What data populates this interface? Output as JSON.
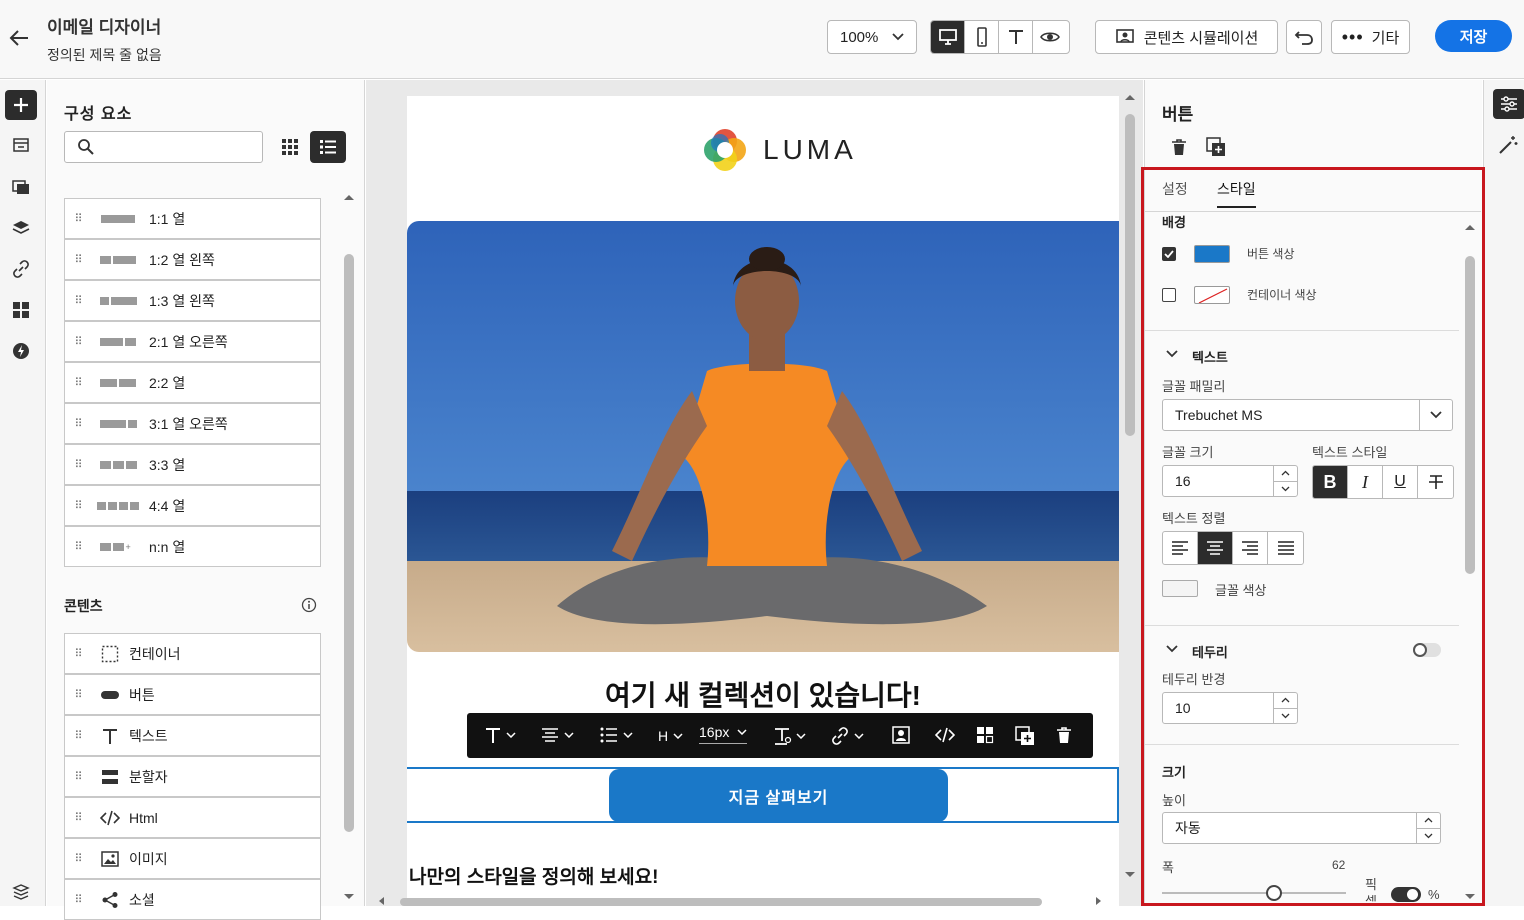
{
  "header": {
    "title": "이메일 디자이너",
    "subtitle": "정의된 제목 줄 없음",
    "zoom": "100%",
    "simulate_label": "콘텐츠 시뮬레이션",
    "more_label": "기타",
    "save_label": "저장"
  },
  "components": {
    "title": "구성 요소",
    "search_placeholder": "",
    "structures": [
      {
        "label": "1:1 열",
        "cols": [
          1
        ]
      },
      {
        "label": "1:2 열 왼쪽",
        "cols": [
          1,
          2
        ]
      },
      {
        "label": "1:3 열 왼쪽",
        "cols": [
          1,
          3
        ]
      },
      {
        "label": "2:1 열 오른쪽",
        "cols": [
          2,
          1
        ]
      },
      {
        "label": "2:2 열",
        "cols": [
          1,
          1
        ]
      },
      {
        "label": "3:1 열 오른쪽",
        "cols": [
          3,
          1
        ]
      },
      {
        "label": "3:3 열",
        "cols": [
          1,
          1,
          1
        ]
      },
      {
        "label": "4:4 열",
        "cols": [
          1,
          1,
          1,
          1
        ]
      },
      {
        "label": "n:n 열",
        "cols": [
          1,
          1,
          0
        ]
      }
    ],
    "content_title": "콘텐츠",
    "content_items": [
      {
        "label": "컨테이너",
        "icon": "container-icon"
      },
      {
        "label": "버튼",
        "icon": "button-icon"
      },
      {
        "label": "텍스트",
        "icon": "text-icon"
      },
      {
        "label": "분할자",
        "icon": "divider-icon"
      },
      {
        "label": "Html",
        "icon": "code-icon"
      },
      {
        "label": "이미지",
        "icon": "image-icon"
      },
      {
        "label": "소셜",
        "icon": "share-icon"
      }
    ]
  },
  "email": {
    "logo_text": "LUMA",
    "headline": "여기 새 컬렉션이 있습니다!",
    "cta_label": "지금 살펴보기",
    "subheadline": "나만의 스타일을 정의해 보세요!",
    "toolbar_font_size": "16px"
  },
  "props": {
    "title": "버튼",
    "tab_settings": "설정",
    "tab_style": "스타일",
    "bg_section": "배경",
    "button_color_label": "버튼 색상",
    "button_color": "#1a78c8",
    "button_color_checked": true,
    "container_color_label": "컨테이너 색상",
    "container_color_checked": false,
    "text_section": "텍스트",
    "font_family_label": "글꼴 패밀리",
    "font_family": "Trebuchet MS",
    "font_size_label": "글꼴 크기",
    "font_size": "16",
    "text_style_label": "텍스트 스타일",
    "text_align_label": "텍스트 정렬",
    "font_color_label": "글꼴 색상",
    "border_section": "테두리",
    "border_enabled": false,
    "border_radius_label": "테두리 반경",
    "border_radius": "10",
    "size_section": "크기",
    "height_label": "높이",
    "height_value": "자동",
    "width_label": "폭",
    "width_value": "62",
    "width_unit_label": "픽셀",
    "percent_label": "%"
  },
  "colors": {
    "accent": "#1a78c8",
    "highlight_box": "#c8171e",
    "selection": "#1a78c8"
  }
}
